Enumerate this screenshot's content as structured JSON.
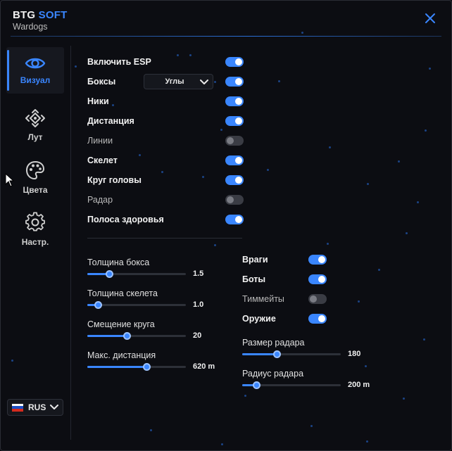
{
  "header": {
    "brand_part1": "BTG",
    "brand_part2": "SOFT",
    "subtitle": "Wardogs"
  },
  "nav": [
    {
      "label": "Визуал",
      "icon": "eye-icon",
      "active": true
    },
    {
      "label": "Лут",
      "icon": "loot-icon",
      "active": false
    },
    {
      "label": "Цвета",
      "icon": "palette-icon",
      "active": false
    },
    {
      "label": "Настр.",
      "icon": "gear-icon",
      "active": false
    }
  ],
  "language": {
    "label": "RUS",
    "flag": "russia-flag-icon"
  },
  "esp": {
    "toggles": [
      {
        "label": "Включить ESP",
        "on": true
      },
      {
        "label": "Боксы",
        "on": true
      },
      {
        "label": "Ники",
        "on": true
      },
      {
        "label": "Дистанция",
        "on": true
      },
      {
        "label": "Линии",
        "on": false
      },
      {
        "label": "Скелет",
        "on": true
      },
      {
        "label": "Круг головы",
        "on": true
      },
      {
        "label": "Радар",
        "on": false
      },
      {
        "label": "Полоса здоровья",
        "on": true
      }
    ],
    "box_style": {
      "value": "Углы"
    }
  },
  "sliders_left": [
    {
      "label": "Толщина бокса",
      "value": "1.5",
      "fraction": 0.22
    },
    {
      "label": "Толщина скелета",
      "value": "1.0",
      "fraction": 0.11
    },
    {
      "label": "Смещение круга",
      "value": "20",
      "fraction": 0.4
    },
    {
      "label": "Макс. дистанция",
      "value": "620 m",
      "fraction": 0.6
    }
  ],
  "targets": [
    {
      "label": "Враги",
      "on": true
    },
    {
      "label": "Боты",
      "on": true
    },
    {
      "label": "Тиммейты",
      "on": false
    },
    {
      "label": "Оружие",
      "on": true
    }
  ],
  "sliders_right": [
    {
      "label": "Размер радара",
      "value": "180",
      "fraction": 0.35
    },
    {
      "label": "Радиус радара",
      "value": "200 m",
      "fraction": 0.14
    }
  ],
  "colors": {
    "accent": "#3a86ff",
    "background": "#0c0d12",
    "toggle_off": "#3a3c44"
  }
}
